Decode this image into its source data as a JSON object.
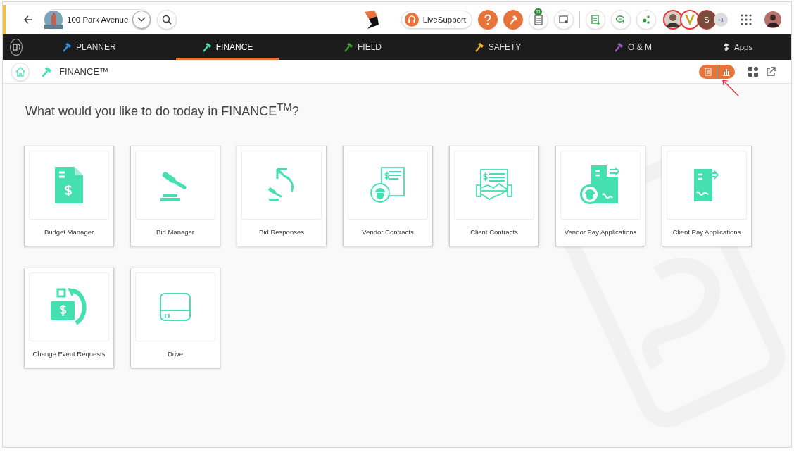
{
  "header": {
    "project": "100 Park Avenue",
    "live_support": "LiveSupport",
    "checklist_badge": "11",
    "member_initial": "S",
    "extra_members": "+1"
  },
  "nav": [
    {
      "label": "PLANNER",
      "color": "#2f8fe8",
      "selected": false
    },
    {
      "label": "FINANCE",
      "color": "#45e0b0",
      "selected": true
    },
    {
      "label": "FIELD",
      "color": "#3a9a2a",
      "selected": false
    },
    {
      "label": "SAFETY",
      "color": "#f0b429",
      "selected": false
    },
    {
      "label": "O & M",
      "color": "#9b59b6",
      "selected": false
    }
  ],
  "apps": "Apps",
  "breadcrumb": "FINANCE™",
  "heading": "What would you like to do today in FINANCE$^{TM}$?",
  "tiles": [
    {
      "label": "Budget Manager",
      "kind": "budget"
    },
    {
      "label": "Bid Manager",
      "kind": "gavel"
    },
    {
      "label": "Bid Responses",
      "kind": "bid-response"
    },
    {
      "label": "Vendor Contracts",
      "kind": "vendor-contract"
    },
    {
      "label": "Client Contracts",
      "kind": "client-contract"
    },
    {
      "label": "Vendor Pay Applications",
      "kind": "vendor-pay"
    },
    {
      "label": "Client Pay Applications",
      "kind": "client-pay"
    },
    {
      "label": "Change Event Requests",
      "kind": "change-event"
    },
    {
      "label": "Drive",
      "kind": "drive"
    }
  ]
}
